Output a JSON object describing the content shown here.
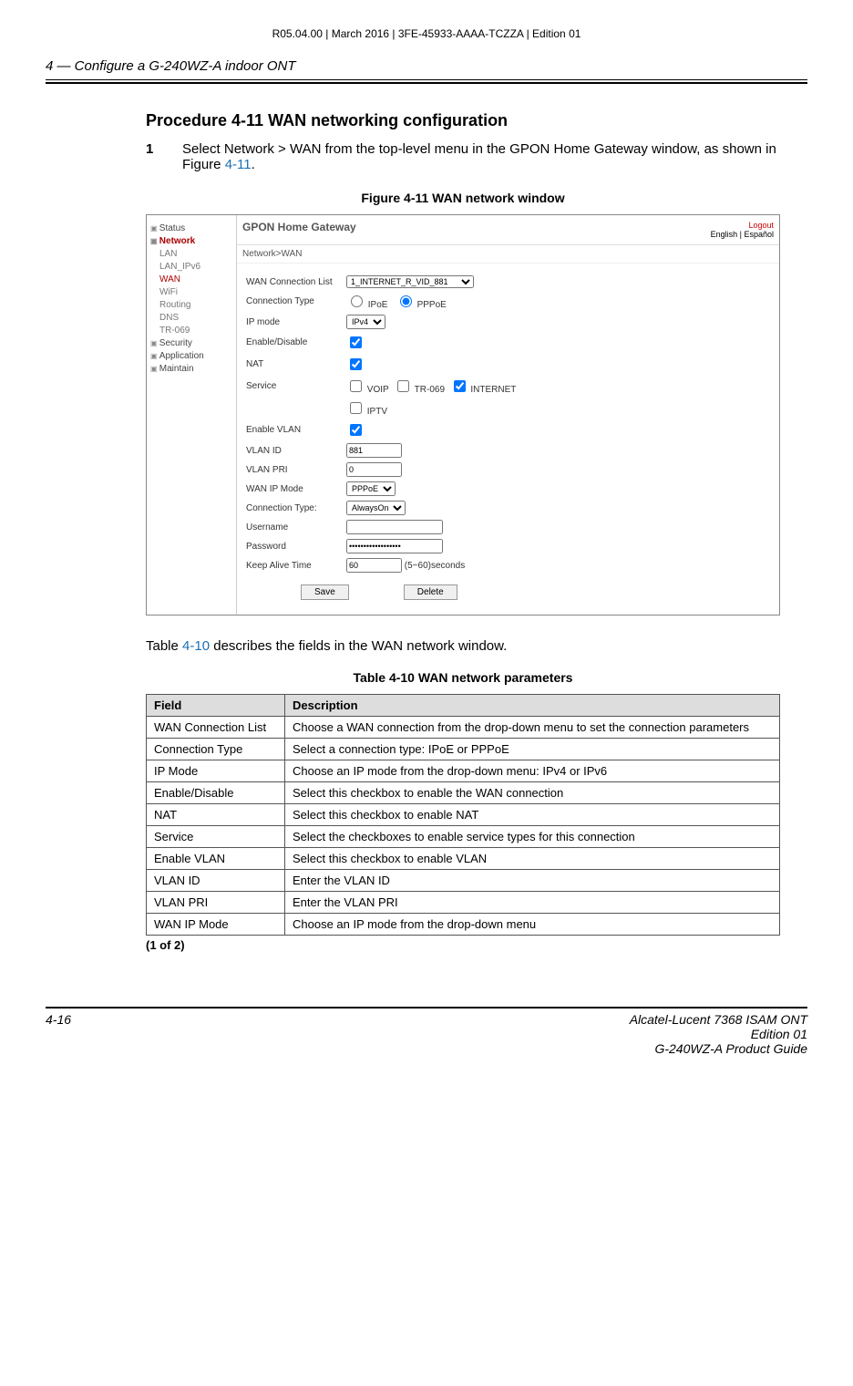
{
  "meta_line": "R05.04.00 | March 2016 | 3FE-45933-AAAA-TCZZA | Edition 01",
  "chapter": "4 —  Configure a G-240WZ-A indoor ONT",
  "procedure_title": "Procedure 4-11  WAN networking configuration",
  "step_num": "1",
  "step_text_a": "Select Network > WAN from the top-level menu in the GPON Home Gateway window, as shown in Figure ",
  "step_link": "4-11",
  "step_text_b": ".",
  "figure_title": "Figure 4-11  WAN network window",
  "screenshot": {
    "header_title": "GPON Home Gateway",
    "logout": "Logout",
    "lang": "English | Español",
    "breadcrumb": "Network>WAN",
    "sidebar": {
      "status": "Status",
      "network": "Network",
      "lan": "LAN",
      "lan_ipv6": "LAN_IPv6",
      "wan": "WAN",
      "wifi": "WiFi",
      "routing": "Routing",
      "dns": "DNS",
      "tr069": "TR-069",
      "security": "Security",
      "application": "Application",
      "maintain": "Maintain"
    },
    "form": {
      "wan_conn_list_lbl": "WAN Connection List",
      "wan_conn_list_val": "1_INTERNET_R_VID_881",
      "conn_type_lbl": "Connection Type",
      "conn_type_ipoe": "IPoE",
      "conn_type_pppoe": "PPPoE",
      "ip_mode_lbl": "IP mode",
      "ip_mode_val": "IPv4",
      "enable_lbl": "Enable/Disable",
      "nat_lbl": "NAT",
      "service_lbl": "Service",
      "service_voip": "VOIP",
      "service_tr069": "TR-069",
      "service_internet": "INTERNET",
      "service_iptv": "IPTV",
      "enable_vlan_lbl": "Enable VLAN",
      "vlan_id_lbl": "VLAN ID",
      "vlan_id_val": "881",
      "vlan_pri_lbl": "VLAN PRI",
      "vlan_pri_val": "0",
      "wan_ip_mode_lbl": "WAN IP Mode",
      "wan_ip_mode_val": "PPPoE",
      "conn_type2_lbl": "Connection Type:",
      "conn_type2_val": "AlwaysOn",
      "username_lbl": "Username",
      "password_lbl": "Password",
      "password_val": "••••••••••••••••••",
      "keep_alive_lbl": "Keep Alive Time",
      "keep_alive_val": "60",
      "keep_alive_note": "(5~60)seconds",
      "save_btn": "Save",
      "delete_btn": "Delete"
    }
  },
  "intro_a": "Table ",
  "intro_link": "4-10",
  "intro_b": " describes the fields in the WAN network window.",
  "table_title": "Table 4-10 WAN network parameters",
  "table_headers": {
    "field": "Field",
    "desc": "Description"
  },
  "rows": [
    {
      "f": "WAN Connection List",
      "d": "Choose a WAN connection from the drop-down menu to set the connection parameters"
    },
    {
      "f": "Connection Type",
      "d": "Select a connection type: IPoE or PPPoE"
    },
    {
      "f": "IP Mode",
      "d": "Choose an IP mode from the drop-down menu: IPv4 or IPv6"
    },
    {
      "f": "Enable/Disable",
      "d": "Select this checkbox to enable the WAN connection"
    },
    {
      "f": "NAT",
      "d": "Select this checkbox to enable NAT"
    },
    {
      "f": "Service",
      "d": "Select the checkboxes to enable service types for this connection"
    },
    {
      "f": "Enable VLAN",
      "d": "Select this checkbox to enable VLAN"
    },
    {
      "f": "VLAN ID",
      "d": "Enter the VLAN ID"
    },
    {
      "f": "VLAN PRI",
      "d": "Enter the VLAN PRI"
    },
    {
      "f": "WAN IP Mode",
      "d": "Choose an IP mode from the drop-down menu"
    }
  ],
  "table_note": "(1 of 2)",
  "footer": {
    "page": "4-16",
    "line1": "Alcatel-Lucent 7368 ISAM ONT",
    "line2": "Edition 01",
    "line3": "G-240WZ-A Product Guide"
  }
}
